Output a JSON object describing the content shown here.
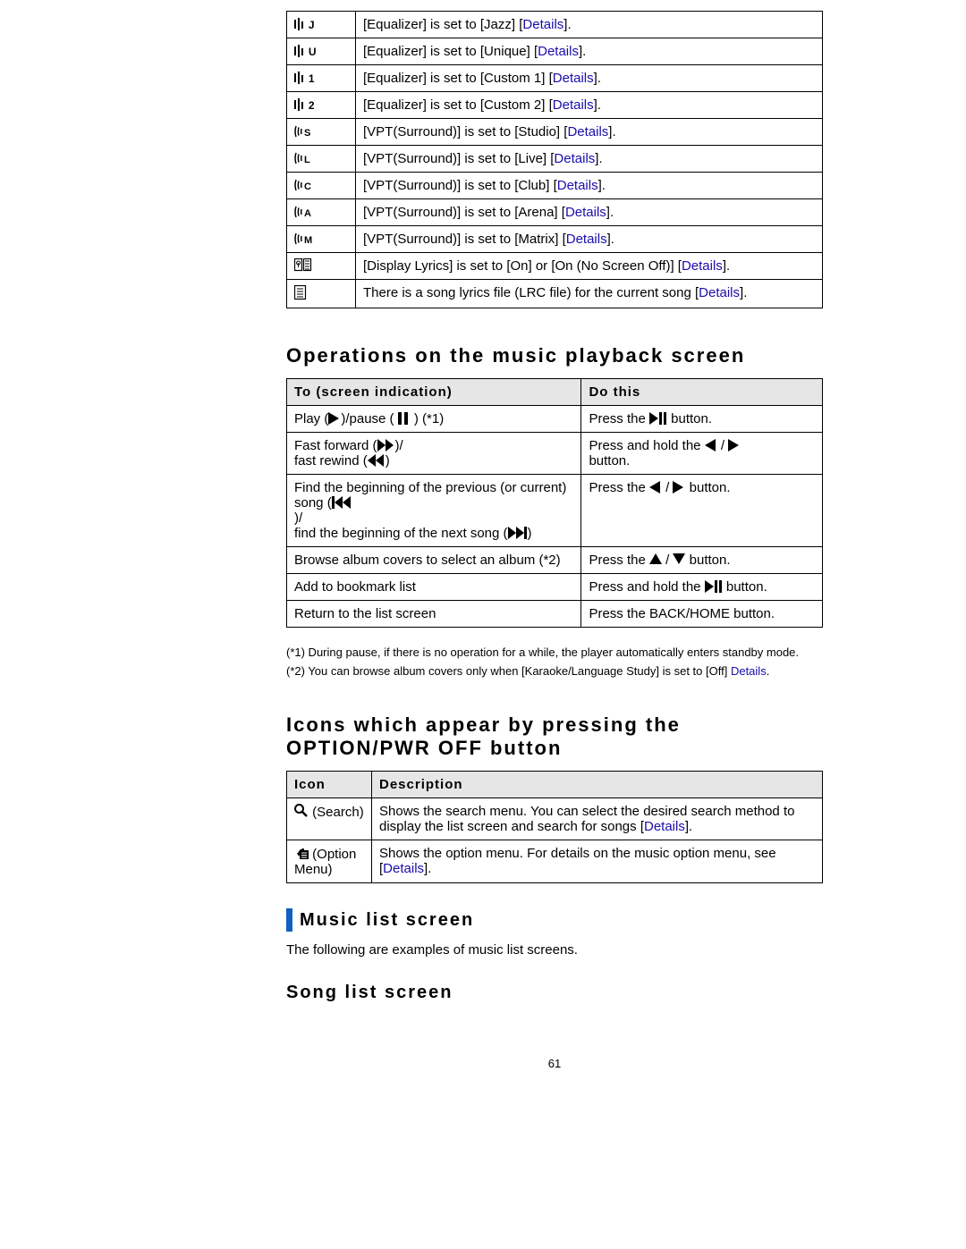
{
  "details_label": "Details",
  "indicators": [
    {
      "icon_letter": "J",
      "prefix": "[Equalizer] is set to [",
      "value": "Jazz",
      "suffix": "] ",
      "has_details": true,
      "end": "."
    },
    {
      "icon_letter": "U",
      "prefix": "[Equalizer] is set to [",
      "value": "Unique",
      "suffix": "] ",
      "has_details": true,
      "end": "."
    },
    {
      "icon_letter": "1",
      "prefix": "[Equalizer] is set to [",
      "value": "Custom 1",
      "suffix": "] ",
      "has_details": true,
      "end": "."
    },
    {
      "icon_letter": "2",
      "prefix": "[Equalizer] is set to [",
      "value": "Custom 2",
      "suffix": "] ",
      "has_details": true,
      "end": "."
    },
    {
      "icon_type": "vpt",
      "icon_letter": "S",
      "prefix": "[VPT(Surround)] is set to [",
      "value": "Studio",
      "suffix": "] ",
      "has_details": true,
      "end": "."
    },
    {
      "icon_type": "vpt",
      "icon_letter": "L",
      "prefix": "[VPT(Surround)] is set to [",
      "value": "Live",
      "suffix": "] ",
      "has_details": true,
      "end": "."
    },
    {
      "icon_type": "vpt",
      "icon_letter": "C",
      "prefix": "[VPT(Surround)] is set to [",
      "value": "Club",
      "suffix": "] ",
      "has_details": true,
      "end": "."
    },
    {
      "icon_type": "vpt",
      "icon_letter": "A",
      "prefix": "[VPT(Surround)] is set to [",
      "value": "Arena",
      "suffix": "] ",
      "has_details": true,
      "end": "."
    },
    {
      "icon_type": "vpt",
      "icon_letter": "M",
      "prefix": "[VPT(Surround)] is set to [",
      "value": "Matrix",
      "suffix": "] ",
      "has_details": true,
      "end": "."
    },
    {
      "icon_type": "lyrics",
      "prefix": "[Display Lyrics] is set to [On] or [On (No Screen Off)] ",
      "value": "",
      "suffix": "",
      "has_details": true,
      "end": "."
    },
    {
      "icon_type": "lrc",
      "prefix": "There is a song lyrics file (LRC file) for the current song ",
      "value": "",
      "suffix": "",
      "has_details": true,
      "end": "."
    }
  ],
  "section_operations": "Operations on the music playback screen",
  "ops_headers": {
    "left": "To (screen indication)",
    "right": "Do this"
  },
  "ops_rows": [
    {
      "left_parts": [
        {
          "t": "Play ("
        },
        {
          "svg": "play"
        },
        {
          "t": ")/pause ( "
        },
        {
          "svg": "pause"
        },
        {
          "t": " ) (*1)"
        }
      ],
      "right_parts": [
        {
          "t": "Press the "
        },
        {
          "svg": "playpause"
        },
        {
          "t": " button."
        }
      ]
    },
    {
      "left_parts": [
        {
          "t": "Fast forward ("
        },
        {
          "svg": "ff"
        },
        {
          "t": ")/"
        },
        {
          "br": true
        },
        {
          "t": "fast rewind ("
        },
        {
          "svg": "rw"
        },
        {
          "t": ")"
        }
      ],
      "right_parts": [
        {
          "t": "Press and hold the  "
        },
        {
          "svg": "left"
        },
        {
          "t": " / "
        },
        {
          "svg": "right"
        },
        {
          "br": true
        },
        {
          "t": "button."
        }
      ]
    },
    {
      "left_parts": [
        {
          "t": "Find the beginning of the previous (or current) song ("
        },
        {
          "svg": "prev"
        },
        {
          "br": true
        },
        {
          "t": ")/"
        },
        {
          "br": true
        },
        {
          "t": "find the beginning of the next song ("
        },
        {
          "svg": "next"
        },
        {
          "t": ")"
        }
      ],
      "right_parts": [
        {
          "t": "Press the  "
        },
        {
          "svg": "left"
        },
        {
          "t": " / "
        },
        {
          "svg": "right"
        },
        {
          "t": "  button."
        }
      ]
    },
    {
      "left_parts": [
        {
          "t": "Browse album covers to select an album (*2)"
        }
      ],
      "right_parts": [
        {
          "t": "Press the  "
        },
        {
          "svg": "up"
        },
        {
          "t": " / "
        },
        {
          "svg": "down"
        },
        {
          "t": "  button."
        }
      ]
    },
    {
      "left_parts": [
        {
          "t": "Add to bookmark list"
        }
      ],
      "right_parts": [
        {
          "t": "Press and hold the "
        },
        {
          "svg": "playpause"
        },
        {
          "t": " button."
        }
      ]
    },
    {
      "left_parts": [
        {
          "t": "Return to the list screen"
        }
      ],
      "right_parts": [
        {
          "t": "Press the BACK/HOME button."
        }
      ]
    }
  ],
  "notes": {
    "n1": "(*1) During pause, if there is no operation for a while, the player automatically enters standby mode.",
    "n2_pre": "(*2) You can browse album covers only when [Karaoke/Language Study] is set to [Off] ",
    "n2_has_details": true,
    "n2_end": "."
  },
  "section_icons": "Icons which appear by pressing the OPTION/PWR OFF button",
  "icons_headers": {
    "left": "Icon",
    "right": "Description"
  },
  "icons_rows": [
    {
      "icon_svg": "search",
      "icon_label": "(Search)",
      "desc_pre": "Shows the search menu. You can select the desired search method to display the list screen and search for songs ",
      "has_details": true,
      "end": "."
    },
    {
      "icon_svg": "option-menu",
      "icon_label": "(Option Menu)",
      "desc_pre": "Shows the option menu. For details on the music option menu, see ",
      "has_details": true,
      "end": "."
    }
  ],
  "section_music_list": "Music list screen",
  "music_list_intro": "The following are examples of music list screens.",
  "section_song_list": "Song list screen",
  "page_number": "61"
}
